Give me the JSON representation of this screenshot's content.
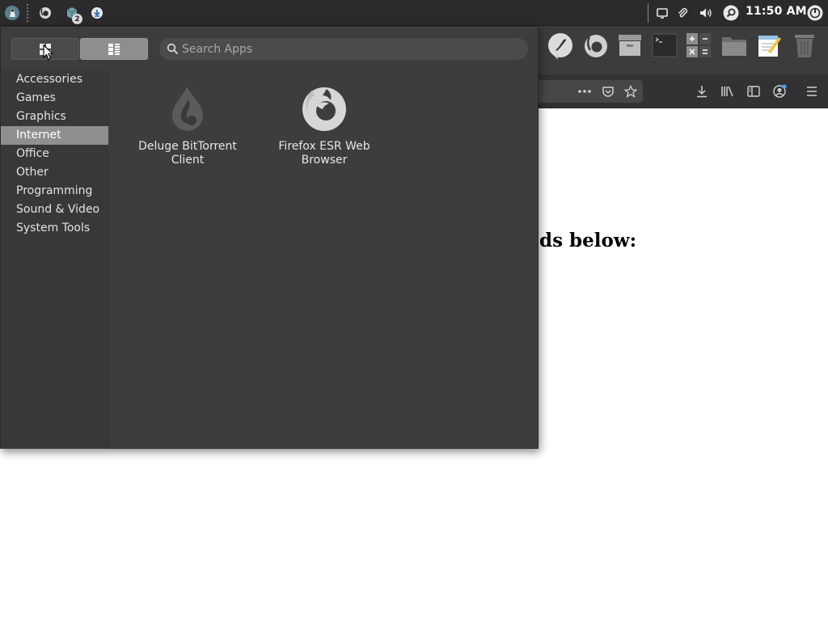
{
  "top_panel": {
    "clock": "11:50 AM",
    "launchers": [
      {
        "icon": "app-menu-icon"
      },
      {
        "icon": "firefox-icon"
      },
      {
        "icon": "workspace-icon",
        "badge": "2"
      },
      {
        "icon": "download-icon"
      }
    ],
    "tray_icons": [
      "display-icon",
      "paperclip-icon",
      "volume-icon",
      "search-icon",
      "power-icon"
    ]
  },
  "browser": {
    "heading_fragment": "ds below:",
    "dock_icons": [
      "rocket-icon",
      "firefox-icon",
      "archive-icon",
      "terminal-icon",
      "calculator-icon",
      "folder-icon",
      "text-editor-icon",
      "trash-icon"
    ],
    "toolbar_icons": [
      "more-actions-icon",
      "pocket-icon",
      "bookmark-star-icon",
      "downloads-icon",
      "library-icon",
      "sidebar-icon",
      "account-icon",
      "hamburger-menu-icon"
    ]
  },
  "app_menu": {
    "search": {
      "placeholder": "Search Apps",
      "value": ""
    },
    "view_modes": [
      {
        "name": "grid-view",
        "state": "inactive"
      },
      {
        "name": "list-view",
        "state": "active"
      }
    ],
    "categories": [
      {
        "label": "Accessories"
      },
      {
        "label": "Games"
      },
      {
        "label": "Graphics"
      },
      {
        "label": "Internet",
        "selected": true
      },
      {
        "label": "Office"
      },
      {
        "label": "Other"
      },
      {
        "label": "Programming"
      },
      {
        "label": "Sound & Video"
      },
      {
        "label": "System Tools"
      }
    ],
    "apps": [
      {
        "label": "Deluge BitTorrent Client",
        "icon": "deluge-icon"
      },
      {
        "label": "Firefox ESR Web Browser",
        "icon": "firefox-icon"
      }
    ]
  },
  "colors": {
    "panel_bg": "#2b2b2b",
    "menu_bg": "#3d3d3d",
    "sidebar_bg": "#383838",
    "selected_bg": "#8f8f8f",
    "text": "#e2e2e2"
  }
}
